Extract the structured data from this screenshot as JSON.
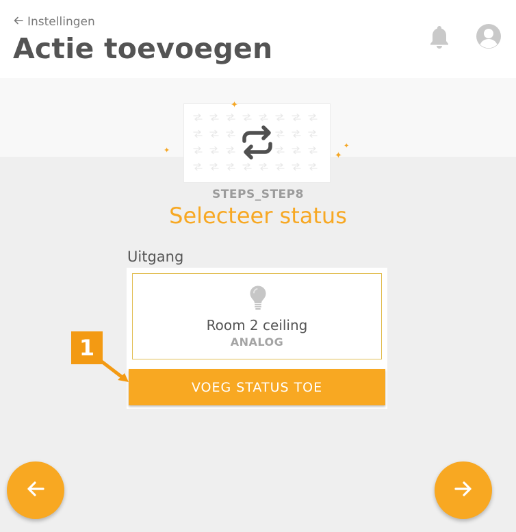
{
  "header": {
    "back_label": "Instellingen",
    "title": "Actie toevoegen",
    "icons": [
      "arrow-left-icon",
      "bell-icon",
      "user-avatar-icon"
    ]
  },
  "step": {
    "code": "STEPS_STEP8",
    "title": "Selecteer status",
    "hero_icon": "repeat-icon"
  },
  "output": {
    "section_label": "Uitgang",
    "device_icon": "lightbulb-icon",
    "name": "Room 2 ceiling",
    "type": "ANALOG",
    "add_button_label": "VOEG STATUS TOE"
  },
  "annotation": {
    "number": "1"
  },
  "navigation": {
    "prev_icon": "arrow-left-icon",
    "next_icon": "arrow-right-icon"
  },
  "colors": {
    "accent": "#f8a822",
    "annotation": "#f39a13",
    "title": "#545454",
    "card_border": "#e2be52"
  }
}
